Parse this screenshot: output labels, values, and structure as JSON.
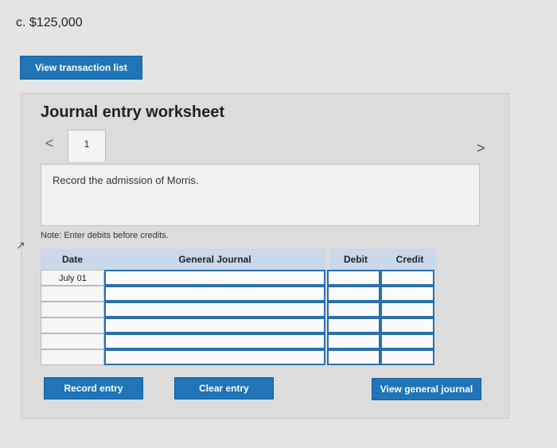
{
  "answer": "c. $125,000",
  "buttons": {
    "view_transaction_list": "View transaction list",
    "record_entry": "Record entry",
    "clear_entry": "Clear entry",
    "view_general_journal": "View general journal"
  },
  "worksheet": {
    "title": "Journal entry worksheet",
    "tab_number": "1",
    "description": "Record the admission of Morris.",
    "note": "Note: Enter debits before credits."
  },
  "table": {
    "headers": {
      "date": "Date",
      "general_journal": "General Journal",
      "debit": "Debit",
      "credit": "Credit"
    },
    "rows": [
      {
        "date": "July 01"
      },
      {
        "date": ""
      },
      {
        "date": ""
      },
      {
        "date": ""
      },
      {
        "date": ""
      },
      {
        "date": ""
      }
    ]
  },
  "icons": {
    "prev": "chevron-left-icon",
    "next": "chevron-right-icon"
  },
  "colors": {
    "button": "#1f75b8",
    "header": "#c9d8ea",
    "input_border": "#2a6fad"
  }
}
